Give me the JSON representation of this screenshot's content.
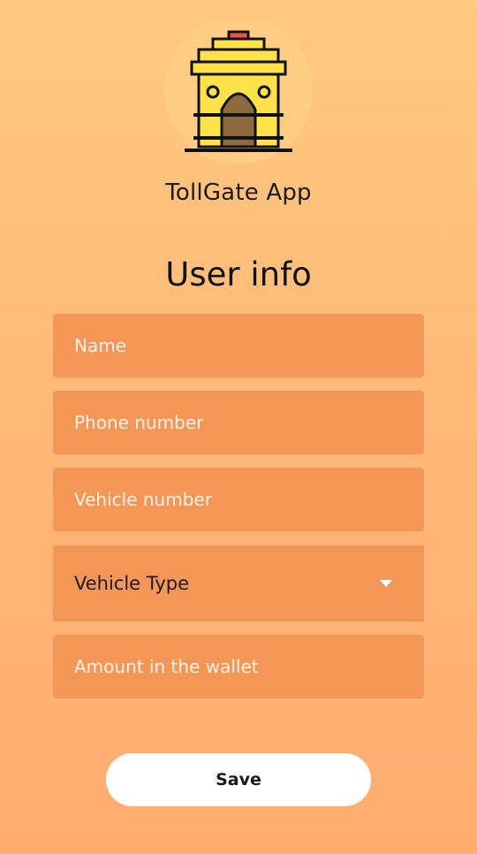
{
  "app": {
    "name": "TollGate App",
    "logo_icon": "india-gate-icon"
  },
  "form": {
    "title": "User info",
    "fields": {
      "name": {
        "placeholder": "Name",
        "value": ""
      },
      "phone": {
        "placeholder": "Phone number",
        "value": ""
      },
      "vehicle_number": {
        "placeholder": "Vehicle number",
        "value": ""
      },
      "vehicle_type": {
        "selected_label": "Vehicle Type",
        "icon": "dropdown-arrow-icon"
      },
      "wallet_amount": {
        "placeholder": "Amount in the wallet",
        "value": ""
      }
    },
    "save_label": "Save"
  },
  "colors": {
    "background_top": "#ffc97f",
    "background_bottom": "#ffad6f",
    "field_fill": "#f49656",
    "button_fill": "#ffffff",
    "logo_yellow": "#ffe14a",
    "logo_arch": "#8b6b3d"
  }
}
